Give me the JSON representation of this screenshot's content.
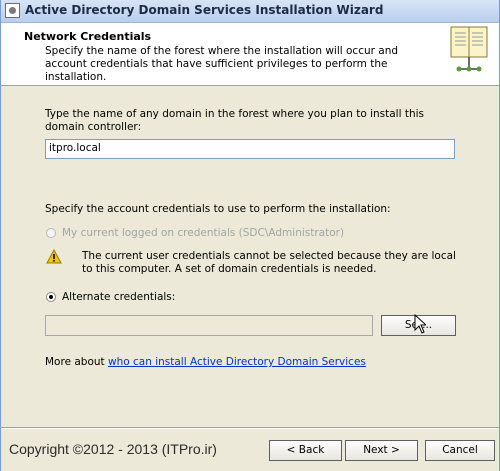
{
  "window": {
    "title": "Active Directory Domain Services Installation Wizard"
  },
  "header": {
    "title": "Network Credentials",
    "description": "Specify the name of the forest where the installation will occur and account credentials that have sufficient privileges to perform the installation."
  },
  "domain": {
    "prompt": "Type the name of any domain in the forest where you plan to install this domain controller:",
    "value": "itpro.local"
  },
  "credentials": {
    "prompt": "Specify the account credentials to use to perform the installation:",
    "current_user_option": "My current logged on credentials (SDC\\Administrator)",
    "warning": "The current user credentials cannot be selected because they are local to this computer. A set of domain credentials is needed.",
    "alternate_option": "Alternate credentials:",
    "alternate_value": "",
    "set_button": "Set..."
  },
  "more_about": {
    "prefix": "More about ",
    "link": "who can install Active Directory Domain Services"
  },
  "footer": {
    "copyright": "Copyright ©2012 - 2013 (ITPro.ir)",
    "back_button": "< Back",
    "next_button": "Next >",
    "cancel_button": "Cancel"
  },
  "colors": {
    "link": "#0033cc",
    "accent": "#7a9cd3"
  }
}
